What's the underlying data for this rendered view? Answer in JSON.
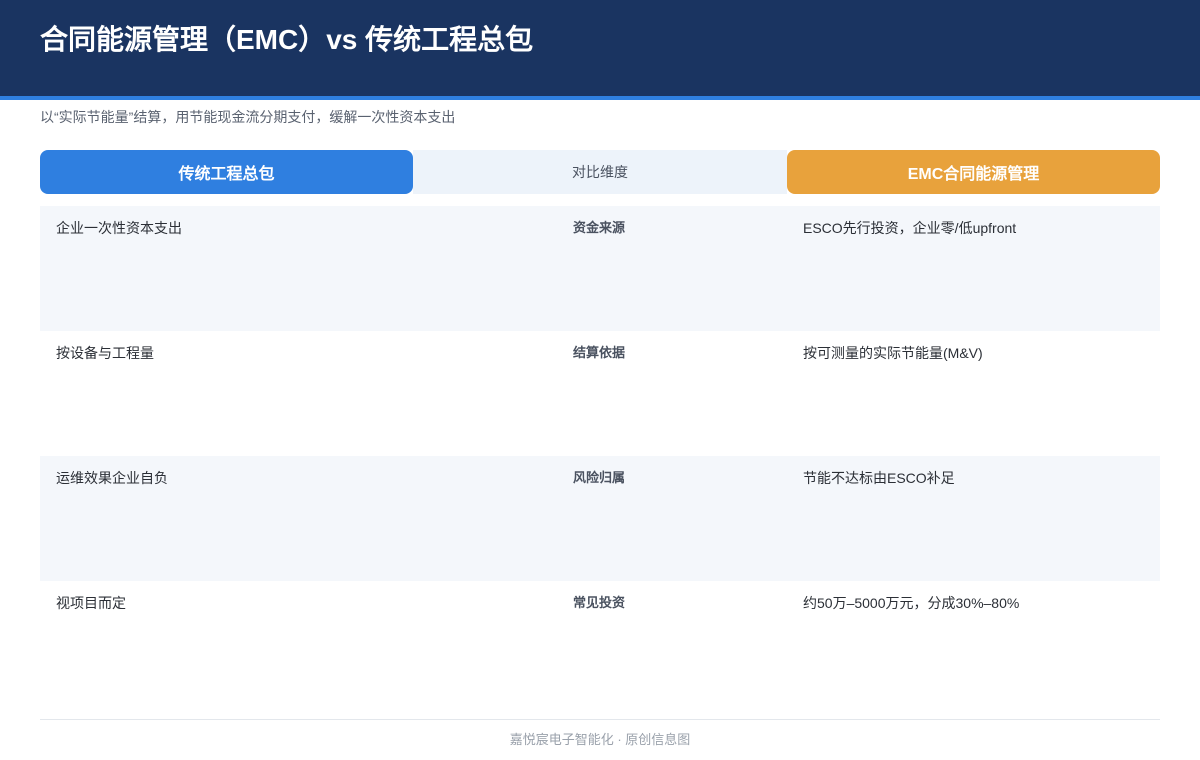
{
  "header": {
    "title": "合同能源管理（EMC）vs 传统工程总包",
    "subtitle": "以“实际节能量”结算，用节能现金流分期支付，缓解一次性资本支出"
  },
  "columns": {
    "left": "传统工程总包",
    "middle": "对比维度",
    "right": "EMC合同能源管理"
  },
  "rows": [
    {
      "traditional": "企业一次性资本支出",
      "dimension": "资金来源",
      "emc": "ESCO先行投资，企业零/低upfront"
    },
    {
      "traditional": "按设备与工程量",
      "dimension": "结算依据",
      "emc": "按可测量的实际节能量(M&V)"
    },
    {
      "traditional": "运维效果企业自负",
      "dimension": "风险归属",
      "emc": "节能不达标由ESCO补足"
    },
    {
      "traditional": "视项目而定",
      "dimension": "常见投资",
      "emc": "约50万–5000万元，分成30%–80%"
    }
  ],
  "footer": {
    "text": "嘉悦宸电子智能化 · 原创信息图"
  },
  "colors": {
    "header_bg": "#1a3461",
    "accent_blue": "#2f7fe0",
    "accent_orange": "#e8a23c",
    "row_shade": "#f4f7fb"
  }
}
